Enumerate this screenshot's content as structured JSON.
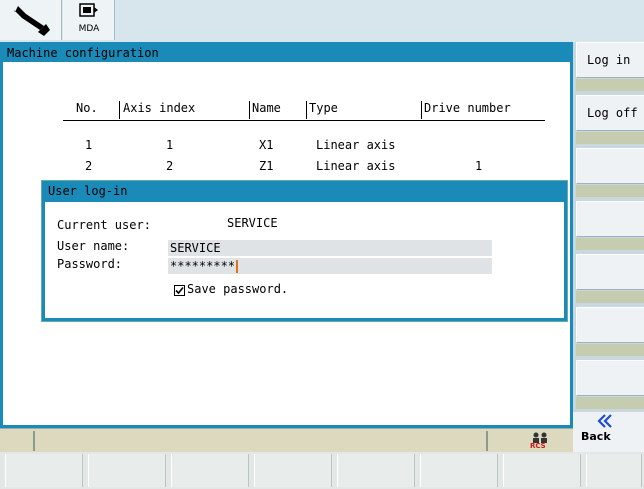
{
  "topbar": {
    "wrench_icon": "wrench-icon",
    "mda_icon": "mda-screen-icon",
    "mda_label": "MDA"
  },
  "main": {
    "title": "Machine configuration",
    "columns": [
      "No.",
      "Axis index",
      "Name",
      "Type",
      "Drive number"
    ],
    "rows": [
      [
        "1",
        "1",
        "X1",
        "Linear axis",
        ""
      ],
      [
        "2",
        "2",
        "Z1",
        "Linear axis",
        "1"
      ]
    ]
  },
  "softkeys": {
    "log_in": "Log in",
    "log_off": "Log off",
    "back": "Back",
    "back_icon": "double-chevron-left-icon"
  },
  "status": {
    "rcs_icon": "rcs-network-icon",
    "rcs_label": "RCS"
  },
  "dialog": {
    "title": "User log-in",
    "current_user_label": "Current user:",
    "current_user_value": "SERVICE",
    "username_label": "User name:",
    "username_value": "SERVICE",
    "password_label": "Password:",
    "password_value": "*********",
    "save_password_label": "Save password.",
    "save_password_checked": true
  },
  "colors": {
    "accent": "#1a8ab8",
    "caret": "#e07020"
  }
}
